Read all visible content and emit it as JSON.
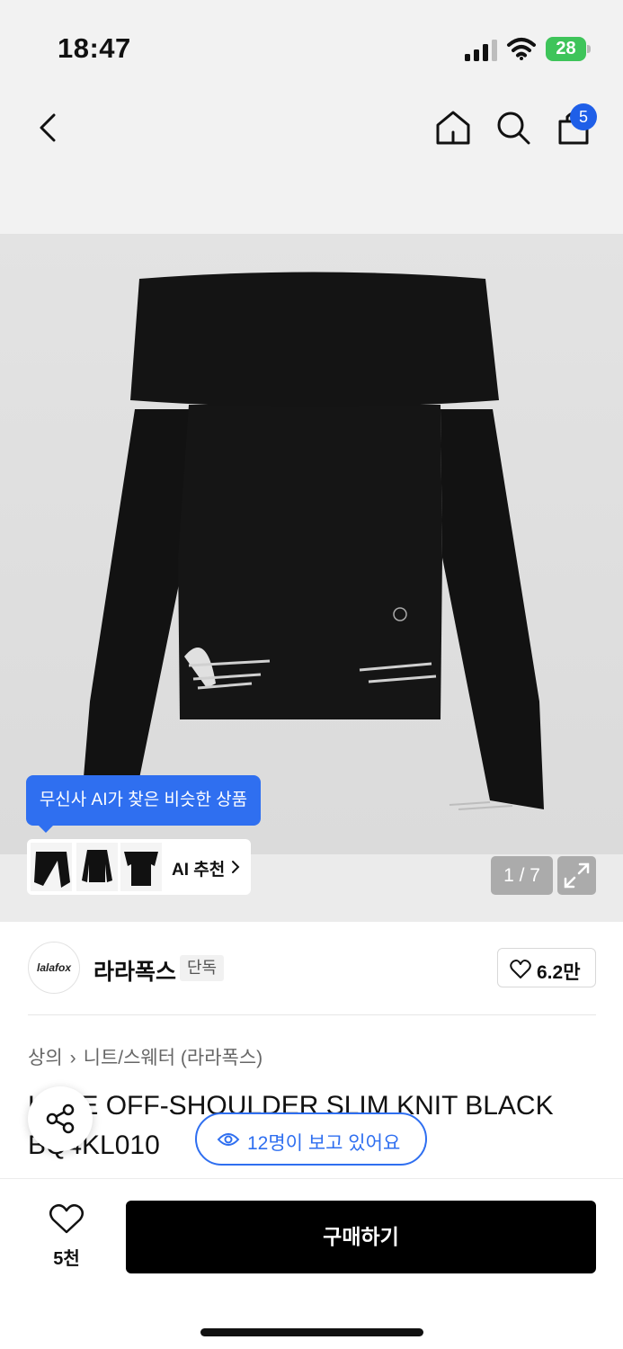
{
  "status_bar": {
    "time": "18:47",
    "battery": "28"
  },
  "nav": {
    "cart_count": "5",
    "icons": [
      "back-icon",
      "home-icon",
      "search-icon",
      "cart-icon"
    ]
  },
  "gallery": {
    "ai_tooltip": "무신사 AI가 찾은 비슷한 상품",
    "ai_recommend_label": "AI 추천",
    "counter": "1 / 7"
  },
  "brand": {
    "logo_text": "lalafox",
    "name": "라라폭스",
    "badge": "단독",
    "likes": "6.2만"
  },
  "breadcrumb": {
    "category": "상의",
    "subcategory": "니트/스웨터 (라라폭스)"
  },
  "product": {
    "title": "LACE OFF-SHOULDER SLIM KNIT BLACK BQ4KL010"
  },
  "viewers": {
    "text": "12명이 보고 있어요"
  },
  "bottom_bar": {
    "wish_count": "5천",
    "buy_label": "구매하기"
  },
  "colors": {
    "accent": "#2f6ff0",
    "buy_button": "#000000",
    "battery": "#3ec45a"
  }
}
